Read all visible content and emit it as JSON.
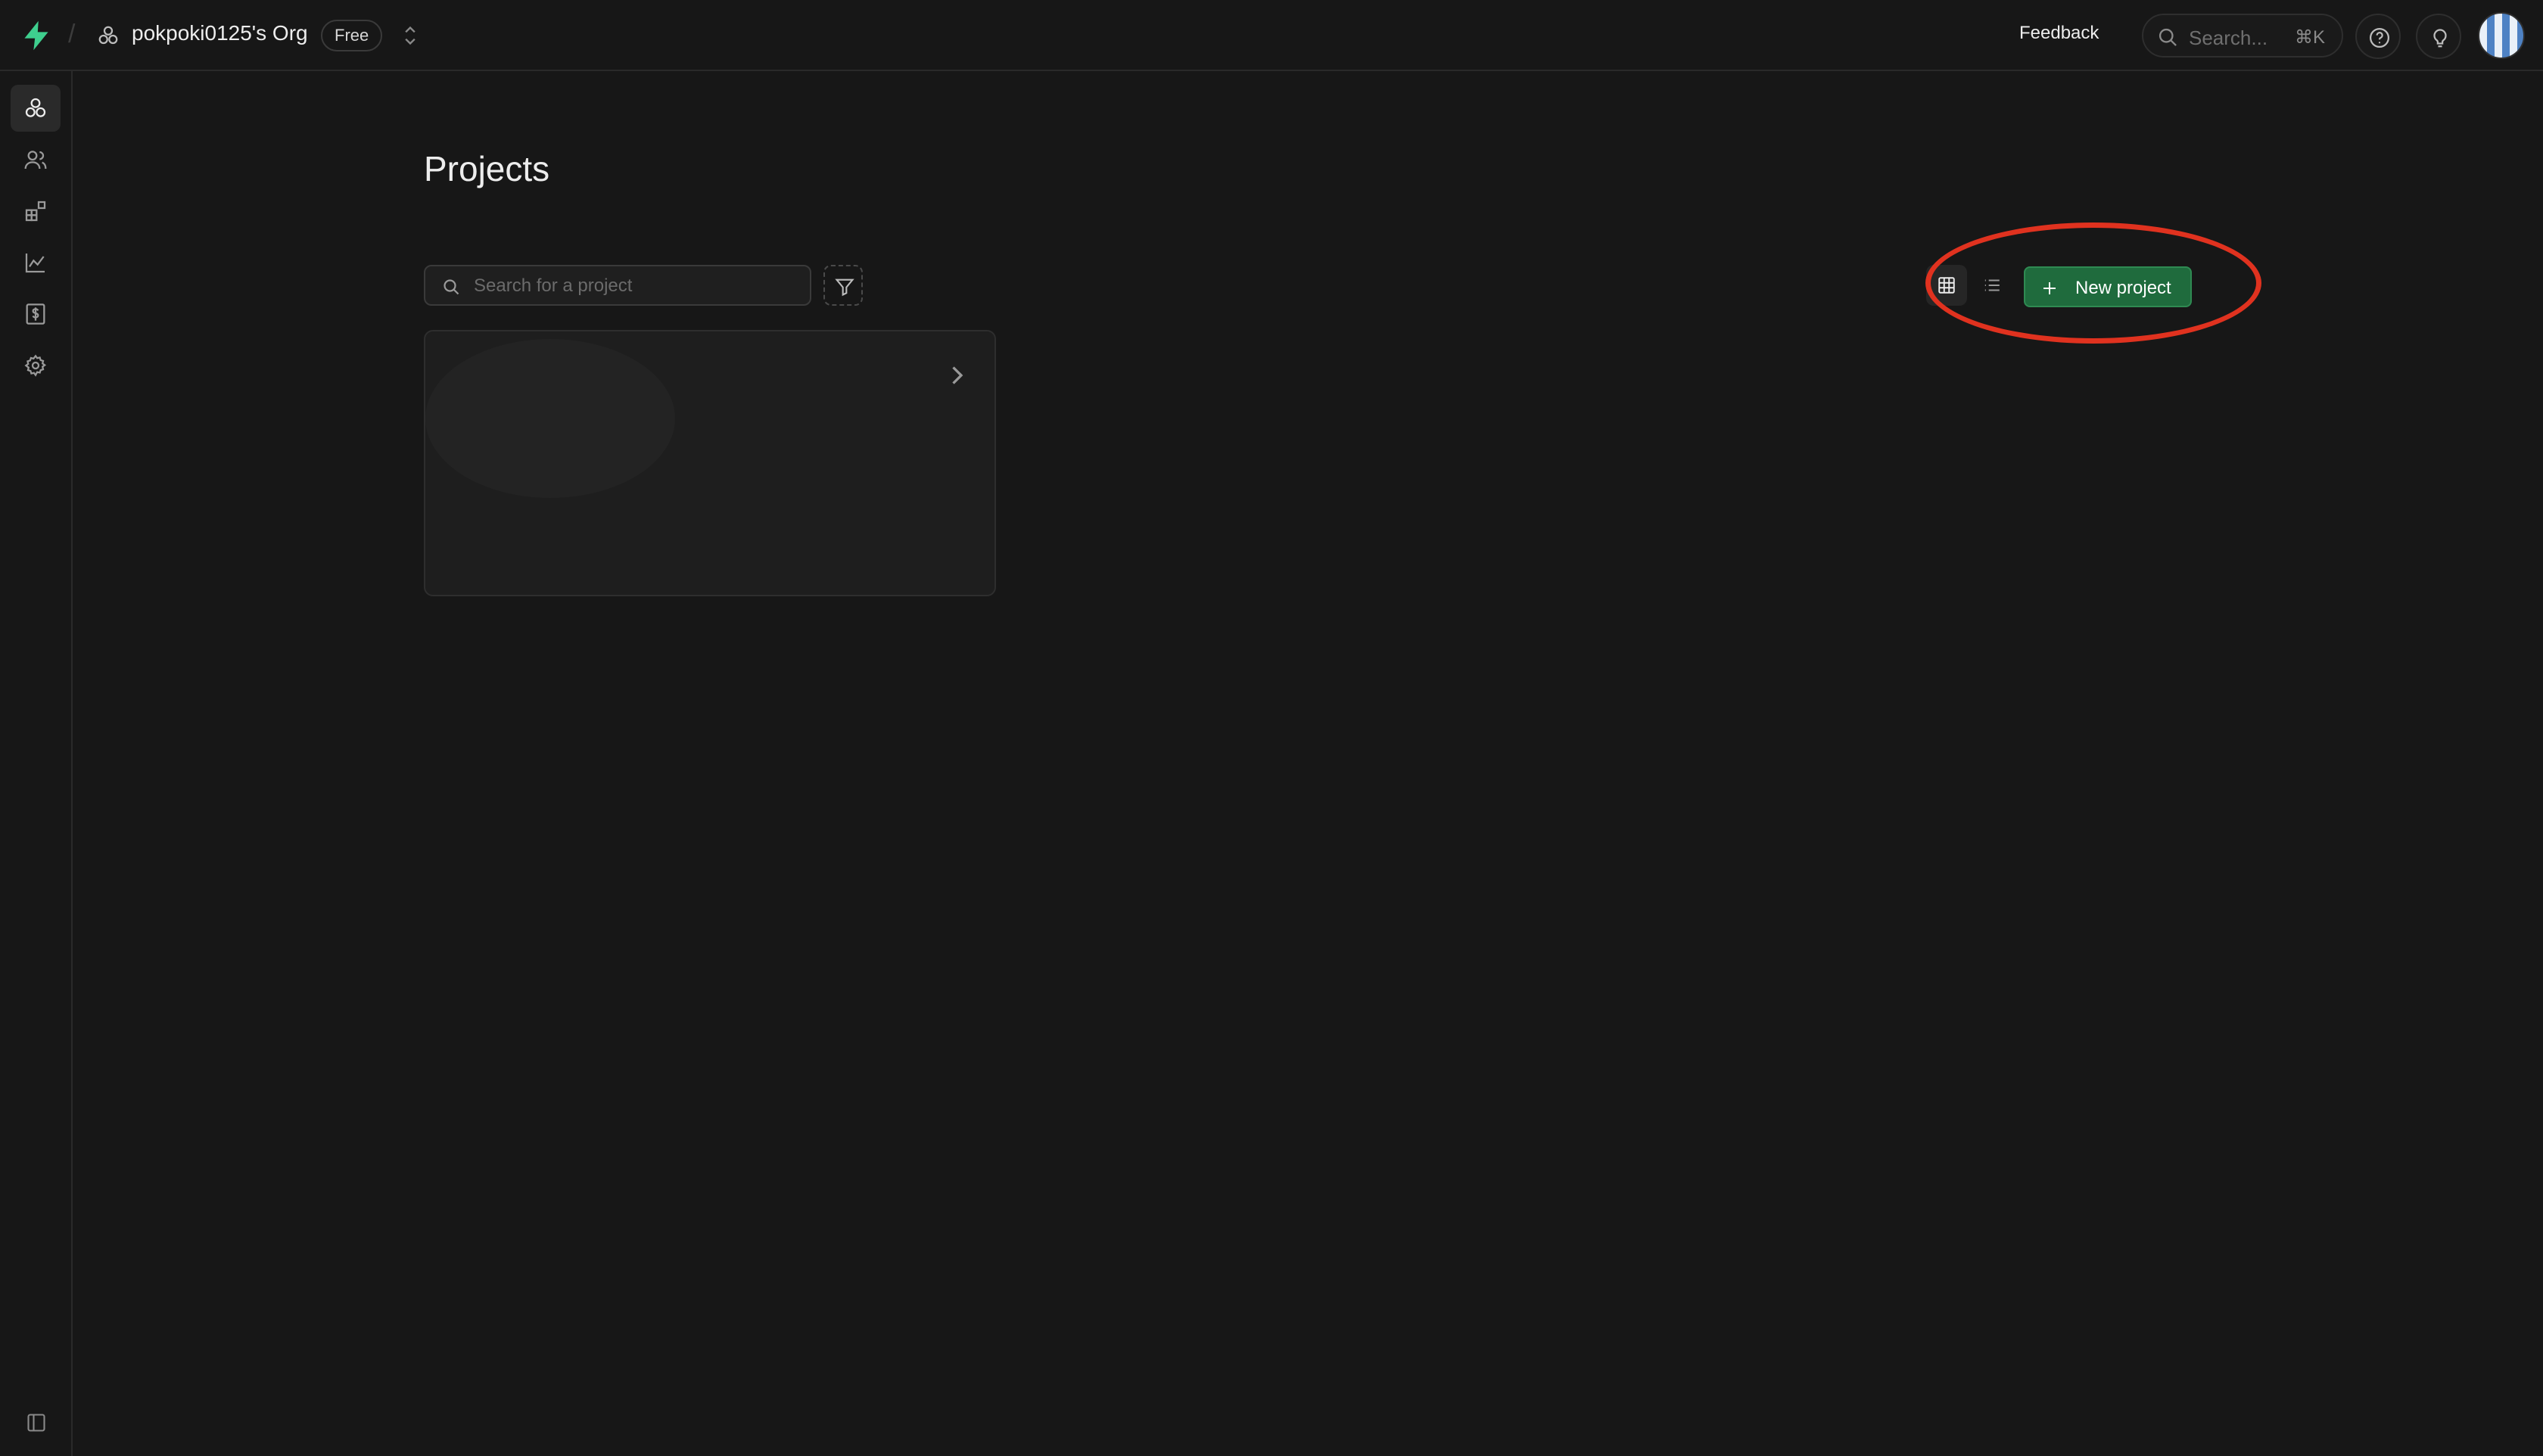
{
  "topbar": {
    "org_name": "pokpoki0125's Org",
    "plan_badge": "Free",
    "feedback_label": "Feedback",
    "search_placeholder": "Search...",
    "search_shortcut": "⌘K"
  },
  "sidebar": {
    "items": [
      {
        "name": "projects",
        "icon": "projects-icon",
        "active": true
      },
      {
        "name": "team",
        "icon": "users-icon",
        "active": false
      },
      {
        "name": "integrations",
        "icon": "integrations-icon",
        "active": false
      },
      {
        "name": "usage",
        "icon": "chart-icon",
        "active": false
      },
      {
        "name": "billing",
        "icon": "billing-icon",
        "active": false
      },
      {
        "name": "settings",
        "icon": "gear-icon",
        "active": false
      }
    ]
  },
  "main": {
    "title": "Projects",
    "search_placeholder": "Search for a project",
    "new_project_label": "New project",
    "view_mode": "grid"
  },
  "colors": {
    "brand_accent": "#3ecf8e",
    "new_project_bg": "#1f6b3d",
    "highlight_ring": "#e0321f"
  }
}
